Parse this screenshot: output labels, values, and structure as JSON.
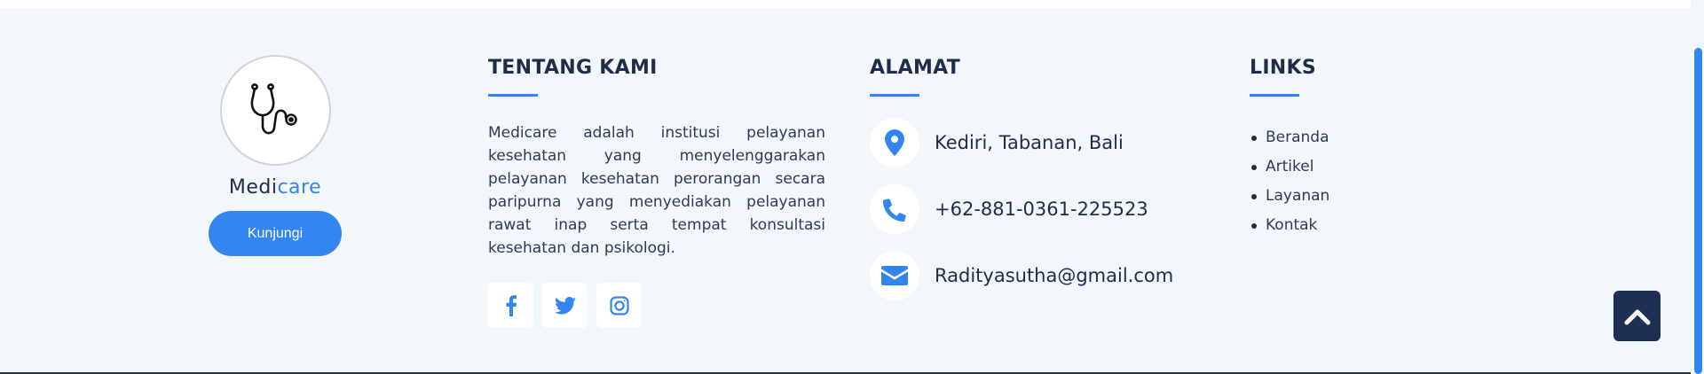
{
  "brand": {
    "name_part1": "Medi",
    "name_part2": "care",
    "button_label": "Kunjungi",
    "logo_icon": "stethoscope-icon"
  },
  "about": {
    "heading": "TENTANG KAMI",
    "text": "Medicare adalah institusi pelayanan kesehatan yang menyelenggarakan pelayanan kesehatan perorangan secara paripurna yang menyediakan pelayanan rawat inap serta tempat konsultasi kesehatan dan psikologi.",
    "socials": [
      {
        "icon": "facebook-icon"
      },
      {
        "icon": "twitter-icon"
      },
      {
        "icon": "instagram-icon"
      }
    ]
  },
  "address": {
    "heading": "ALAMAT",
    "location": "Kediri, Tabanan, Bali",
    "phone": "+62-881-0361-225523",
    "email": "Radityasutha@gmail.com"
  },
  "links": {
    "heading": "LINKS",
    "items": [
      "Beranda",
      "Artikel",
      "Layanan",
      "Kontak"
    ]
  },
  "colors": {
    "accent": "#3385f0",
    "navy": "#1d2f52",
    "background": "#f2f7fc"
  }
}
